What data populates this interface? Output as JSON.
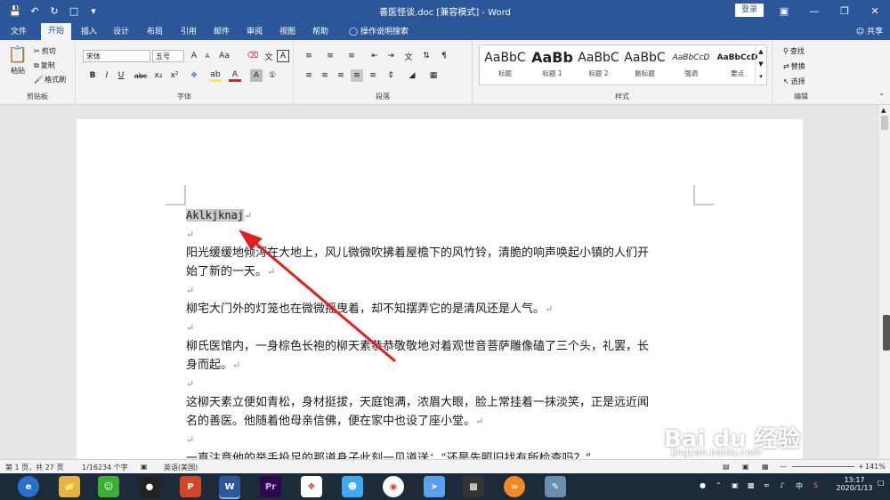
{
  "titlebar": {
    "title": "善医怪谈.doc [兼容模式] - Word",
    "login": "登录"
  },
  "tabs": [
    "文件",
    "开始",
    "插入",
    "设计",
    "布局",
    "引用",
    "邮件",
    "审阅",
    "视图",
    "帮助"
  ],
  "tell_me": "操作说明搜索",
  "share": "共享",
  "clipboard": {
    "paste": "粘贴",
    "cut": "剪切",
    "copy": "复制",
    "format_painter": "格式刷",
    "label": "剪贴板"
  },
  "font": {
    "family": "宋体",
    "size": "五号",
    "label": "字体",
    "bold": "B",
    "italic": "I",
    "underline": "U",
    "strike": "abc",
    "sub": "x₂",
    "sup": "x²",
    "grow": "A",
    "shrink": "A",
    "case": "Aa",
    "wen": "文",
    "highlight": "ab",
    "color": "A",
    "ruby": "A"
  },
  "paragraph": {
    "label": "段落"
  },
  "styles": {
    "label": "样式",
    "items": [
      {
        "sample": "AaBbC",
        "name": "标题"
      },
      {
        "sample": "AaBb",
        "name": "标题 1"
      },
      {
        "sample": "AaBbC",
        "name": "标题 2"
      },
      {
        "sample": "AaBbC",
        "name": "副标题"
      },
      {
        "sample": "AaBbCcD",
        "name": "强调"
      },
      {
        "sample": "AaBbCcD",
        "name": "要点"
      }
    ]
  },
  "editing": {
    "find": "查找",
    "replace": "替换",
    "select": "选择",
    "label": "编辑"
  },
  "document": {
    "lines": [
      "Aklkjknaj",
      "",
      "阳光缓缓地倾泻在大地上，风儿微微吹拂着屋檐下的风竹铃，清脆的响声唤起小镇的人们开",
      "始了新的一天。",
      "",
      "柳宅大门外的灯笼也在微微摇曳着，却不知摆弄它的是清风还是人气。",
      "",
      "柳氏医馆内，一身棕色长袍的柳天素恭恭敬敬地对着观世音菩萨雕像磕了三个头，礼罢，长",
      "身而起。",
      "",
      "这柳天素立便如青松，身材挺拔，天庭饱满，浓眉大眼，脸上常挂着一抹淡笑，正是远近闻",
      "名的善医。他随着他母亲信佛，便在家中也设了座小堂。",
      "",
      "一直注意他的举手投足的那道身子此刻一见道送：“还是先照旧找有所检查吗？”"
    ]
  },
  "status": {
    "page": "第 1 页，共 27 页",
    "words": "1/16234 个字",
    "lang": "英语(美国)",
    "zoom": "141%"
  },
  "taskbar": {
    "time": "13:17",
    "date": "2020/1/13",
    "ime": "中"
  },
  "watermark": {
    "brand": "Bai du 经验",
    "url": "jingyan.baidu.com"
  },
  "colors": {
    "accent": "#2b579a",
    "arrow": "#e02020"
  }
}
